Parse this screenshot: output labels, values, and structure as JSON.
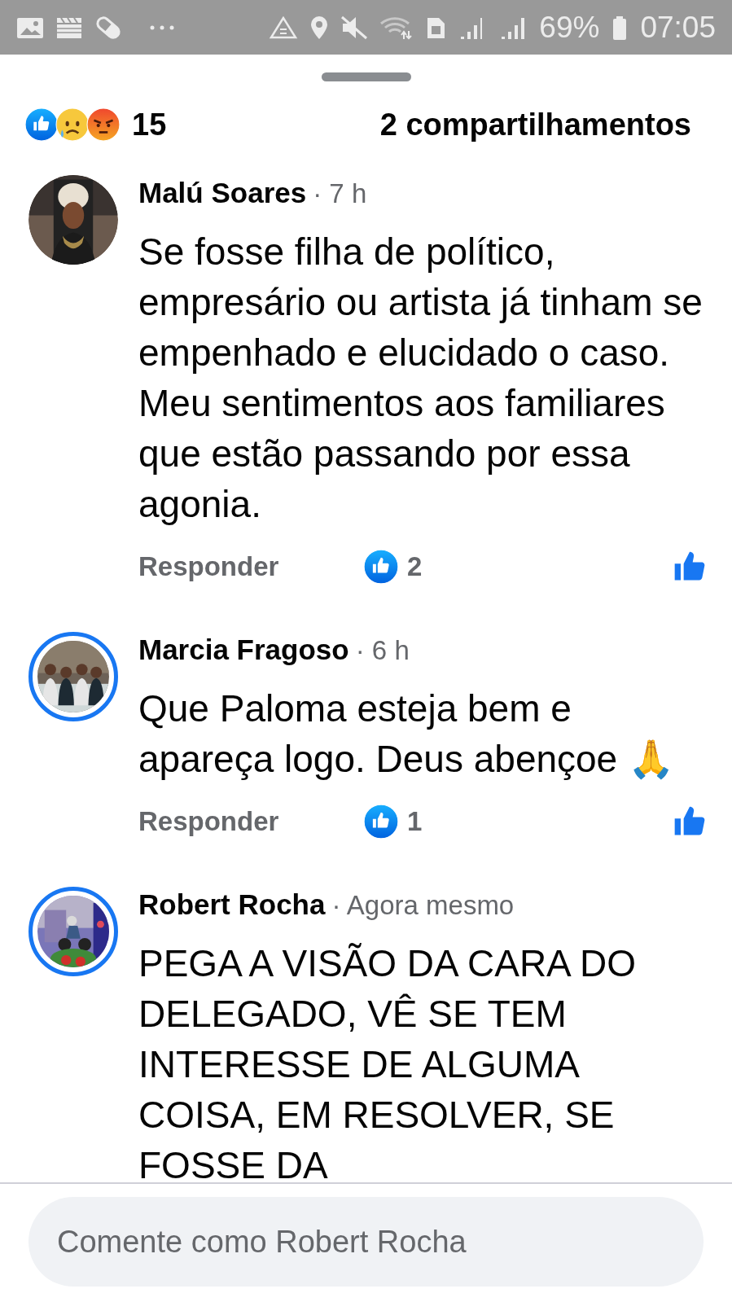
{
  "status_bar": {
    "battery": "69%",
    "time": "07:05"
  },
  "reactions": {
    "count": "15",
    "shares": "2 compartilhamentos"
  },
  "comments": [
    {
      "author": "Malú Soares",
      "time": "· 7 h",
      "story_ring": false,
      "text": "Se fosse filha de político, empresário ou artista já tinham se empenhado e elucidado o caso.\nMeu sentimentos aos familiares que estão passando por essa agonia.",
      "reply": "Responder",
      "likes": "2"
    },
    {
      "author": "Marcia Fragoso",
      "time": "· 6 h",
      "story_ring": true,
      "text": "Que Paloma esteja bem e apareça logo. Deus abençoe 🙏",
      "reply": "Responder",
      "likes": "1"
    },
    {
      "author": "Robert Rocha",
      "time": "· Agora mesmo",
      "story_ring": true,
      "text": "PEGA A VISÃO DA CARA DO DELEGADO, VÊ SE TEM INTERESSE DE ALGUMA COISA, EM RESOLVER, SE FOSSE DA"
    }
  ],
  "composer": {
    "placeholder": "Comente como Robert Rocha"
  }
}
